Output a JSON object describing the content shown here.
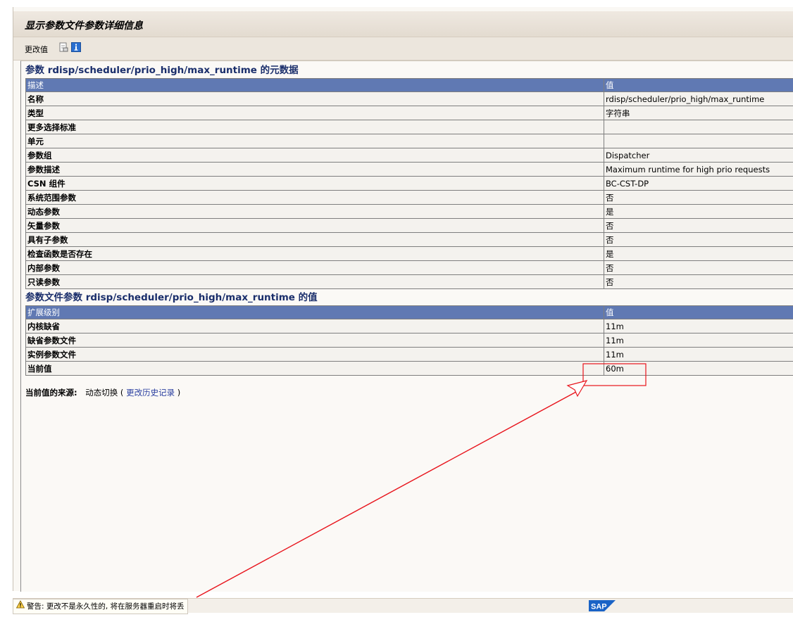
{
  "window": {
    "title": "显示参数文件参数详细信息"
  },
  "toolbar": {
    "change_value_label": "更改值",
    "doc_icon": "document-icon",
    "info_icon": "info-icon"
  },
  "metadata": {
    "section_title": "参数 rdisp/scheduler/prio_high/max_runtime 的元数据",
    "header": {
      "col1": "描述",
      "col2": "值"
    },
    "rows": [
      {
        "desc": "名称",
        "value": "rdisp/scheduler/prio_high/max_runtime"
      },
      {
        "desc": "类型",
        "value": "字符串"
      },
      {
        "desc": "更多选择标准",
        "value": ""
      },
      {
        "desc": "单元",
        "value": ""
      },
      {
        "desc": "参数组",
        "value": "Dispatcher"
      },
      {
        "desc": "参数描述",
        "value": "Maximum runtime for high prio requests"
      },
      {
        "desc": "CSN 组件",
        "value": "BC-CST-DP"
      },
      {
        "desc": "系统范围参数",
        "value": "否"
      },
      {
        "desc": "动态参数",
        "value": "是"
      },
      {
        "desc": "矢量参数",
        "value": "否"
      },
      {
        "desc": "具有子参数",
        "value": "否"
      },
      {
        "desc": "检查函数是否存在",
        "value": "是"
      },
      {
        "desc": "内部参数",
        "value": "否"
      },
      {
        "desc": "只读参数",
        "value": "否"
      }
    ]
  },
  "values": {
    "section_title": "参数文件参数 rdisp/scheduler/prio_high/max_runtime 的值",
    "header": {
      "col1": "扩展级别",
      "col2": "值"
    },
    "rows": [
      {
        "desc": "内核缺省",
        "value": "11m"
      },
      {
        "desc": "缺省参数文件",
        "value": "11m"
      },
      {
        "desc": "实例参数文件",
        "value": "11m"
      },
      {
        "desc": "当前值",
        "value": "60m"
      }
    ]
  },
  "source": {
    "label": "当前值的来源:",
    "value": "动态切换",
    "open_paren": "(",
    "link": "更改历史记录",
    "close_paren": ")"
  },
  "status": {
    "warning_icon": "warning-icon",
    "warning_text": "警告: 更改不是永久性的, 将在服务器重启时将丢",
    "logo_text": "SAP"
  },
  "colors": {
    "header_bg": "#6079b3",
    "section_title": "#1a2e6b",
    "link": "#2a3fa0",
    "annotation": "#e8141c"
  }
}
